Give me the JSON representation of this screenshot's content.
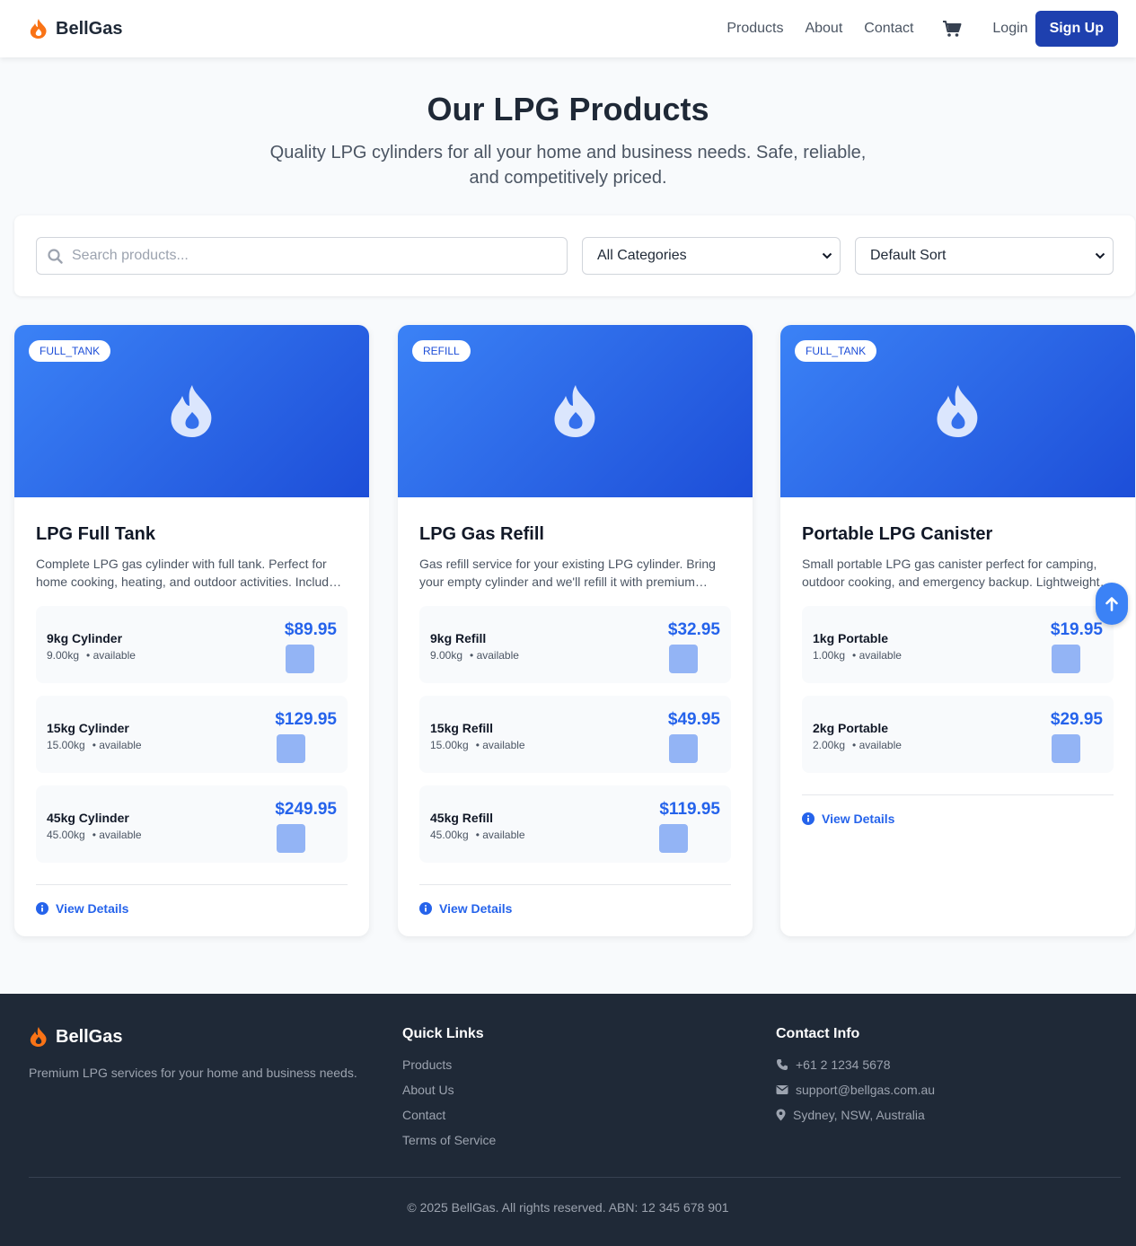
{
  "header": {
    "brand": "BellGas",
    "nav": [
      "Products",
      "About",
      "Contact"
    ],
    "login": "Login",
    "signup": "Sign Up"
  },
  "hero": {
    "title": "Our LPG Products",
    "subtitle": "Quality LPG cylinders for all your home and business needs. Safe, reliable, and competitively priced."
  },
  "filters": {
    "search_placeholder": "Search products...",
    "category": "All Categories",
    "sort": "Default Sort"
  },
  "products": [
    {
      "badge": "FULL_TANK",
      "title": "LPG Full Tank",
      "description": "Complete LPG gas cylinder with full tank. Perfect for home cooking, heating, and outdoor activities. Includes cylinder and full gas tank.",
      "variants": [
        {
          "name": "9kg Cylinder",
          "weight": "9.00kg",
          "status": "• available",
          "price": "$89.95"
        },
        {
          "name": "15kg Cylinder",
          "weight": "15.00kg",
          "status": "• available",
          "price": "$129.95"
        },
        {
          "name": "45kg Cylinder",
          "weight": "45.00kg",
          "status": "• available",
          "price": "$249.95"
        }
      ],
      "details": "View Details"
    },
    {
      "badge": "REFILL",
      "title": "LPG Gas Refill",
      "description": "Gas refill service for your existing LPG cylinder. Bring your empty cylinder and we'll refill it with premium quality gas.",
      "variants": [
        {
          "name": "9kg Refill",
          "weight": "9.00kg",
          "status": "• available",
          "price": "$32.95"
        },
        {
          "name": "15kg Refill",
          "weight": "15.00kg",
          "status": "• available",
          "price": "$49.95"
        },
        {
          "name": "45kg Refill",
          "weight": "45.00kg",
          "status": "• available",
          "price": "$119.95"
        }
      ],
      "details": "View Details"
    },
    {
      "badge": "FULL_TANK",
      "title": "Portable LPG Canister",
      "description": "Small portable LPG gas canister perfect for camping, outdoor cooking, and emergency backup. Lightweight and easy to carry.",
      "variants": [
        {
          "name": "1kg Portable",
          "weight": "1.00kg",
          "status": "• available",
          "price": "$19.95"
        },
        {
          "name": "2kg Portable",
          "weight": "2.00kg",
          "status": "• available",
          "price": "$29.95"
        }
      ],
      "details": "View Details"
    }
  ],
  "footer": {
    "brand": "BellGas",
    "tagline": "Premium LPG services for your home and business needs.",
    "links_heading": "Quick Links",
    "links": [
      "Products",
      "About Us",
      "Contact",
      "Terms of Service"
    ],
    "contact_heading": "Contact Info",
    "phone": "+61 2 1234 5678",
    "email": "support@bellgas.com.au",
    "address": "Sydney, NSW, Australia",
    "copyright": "© 2025 BellGas. All rights reserved. ABN: 12 345 678 901"
  },
  "colors": {
    "accent": "#2563eb",
    "brand_orange": "#f97316",
    "primary_button": "#1e40af",
    "footer_bg": "#1f2937"
  },
  "icons": {
    "brand": "fire-icon",
    "cart": "cart-icon",
    "search": "search-icon",
    "info": "info-icon",
    "scroll": "arrow-up-icon",
    "phone": "phone-icon",
    "email": "envelope-icon",
    "location": "map-pin-icon"
  }
}
